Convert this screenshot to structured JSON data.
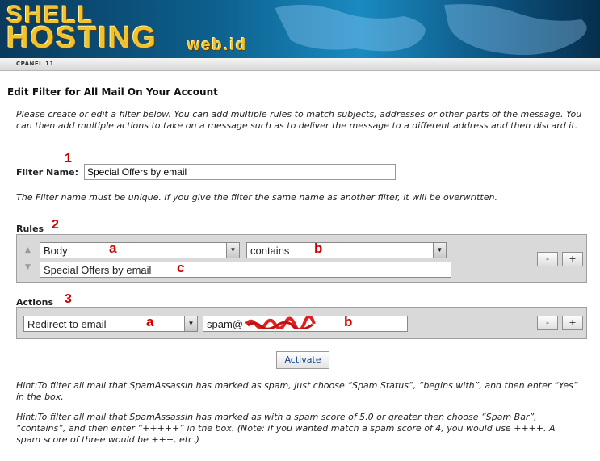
{
  "header": {
    "logo_top": "SHELL",
    "logo_bottom": "HOSTING",
    "logo_suffix": "web.id",
    "subbar_text": "CPANEL 11"
  },
  "page": {
    "title": "Edit Filter for All Mail On Your Account",
    "intro": "Please create or edit a filter below. You can add multiple rules to match subjects, addresses or other parts of the message. You can then add multiple actions to take on a message such as to deliver the message to a different address and then discard it."
  },
  "filter_name": {
    "label": "Filter Name:",
    "value": "Special Offers by email",
    "note": "The Filter name must be unique. If you give the filter the same name as another filter, it will be overwritten."
  },
  "rules": {
    "label": "Rules",
    "field_select": "Body",
    "operator_select": "contains",
    "value": "Special Offers by email",
    "minus_label": "-",
    "plus_label": "+"
  },
  "actions": {
    "label": "Actions",
    "action_select": "Redirect to email",
    "destination": "spam@",
    "minus_label": "-",
    "plus_label": "+"
  },
  "activate_label": "Activate",
  "hints": [
    "Hint:To filter all mail that SpamAssassin has marked as spam, just choose “Spam Status”, “begins with”, and then enter “Yes” in the box.",
    "Hint:To filter all mail that SpamAssassin has marked as with a spam score of 5.0 or greater then choose “Spam Bar”, “contains”, and then enter “+++++” in the box. (Note: if you wanted match a spam score of 4, you would use ++++. A spam score of three would be +++, etc.)"
  ],
  "annotations": {
    "n1": "1",
    "n2": "2",
    "n3": "3",
    "rule_a": "a",
    "rule_b": "b",
    "rule_c": "c",
    "action_a": "a",
    "action_b": "b"
  },
  "colors": {
    "annotation_red": "#cc0000",
    "banner_blue": "#0d5f8d",
    "logo_gold": "#f2c12e",
    "panel_gray": "#d9d9d9"
  }
}
